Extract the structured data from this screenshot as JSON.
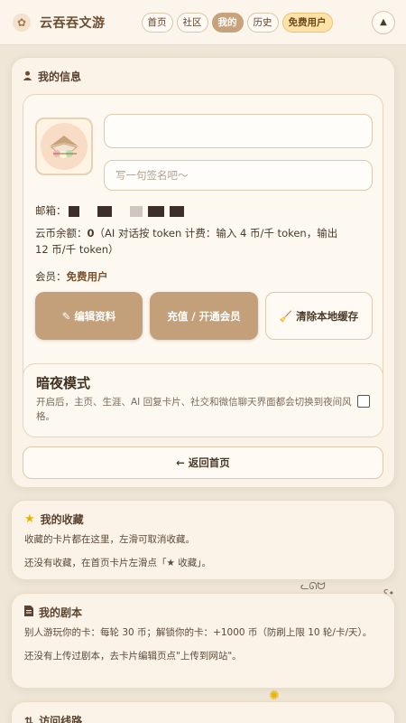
{
  "nav": {
    "brand": "云吞吞文游",
    "tabs": [
      "首页",
      "社区",
      "我的",
      "历史"
    ],
    "badge": "免费用户",
    "up_icon": "▲"
  },
  "profile": {
    "section_title": "我的信息",
    "name_placeholder": "",
    "signature_placeholder": "写一句签名吧～",
    "email_label": "邮箱：",
    "coin_label": "云币余额：",
    "coin_value": "0",
    "coin_note": "（AI 对话按 token 计费：输入 4 币/千 token，输出 12 币/千 token）",
    "member_label": "会员：",
    "member_value": "免费用户",
    "buttons": {
      "edit": "编辑资料",
      "recharge": "充值 / 开通会员",
      "clear": "清除本地缓存"
    }
  },
  "dark_mode": {
    "title": "暗夜模式",
    "description": "开启后，主页、生涯、AI 回复卡片、社交和微信聊天界面都会切换到夜间风格。",
    "checked": false
  },
  "back_home": "← 返回首页",
  "favorites": {
    "title": "我的收藏",
    "desc": "收藏的卡片都在这里，左滑可取消收藏。",
    "empty": "还没有收藏，在首页卡片左滑点「★ 收藏」。"
  },
  "scripts": {
    "title": "我的剧本",
    "desc": "别人游玩你的卡：每轮 30 币；解锁你的卡：+1000 币（防刷上限 10 轮/卡/天）。",
    "empty": "还没有上传过剧本，去卡片编辑页点\"上传到网站\"。"
  },
  "route": {
    "title": "访问线路"
  },
  "colors": {
    "accent": "#c4a07a",
    "background": "#efe6d8",
    "card": "#fbf3e7"
  }
}
